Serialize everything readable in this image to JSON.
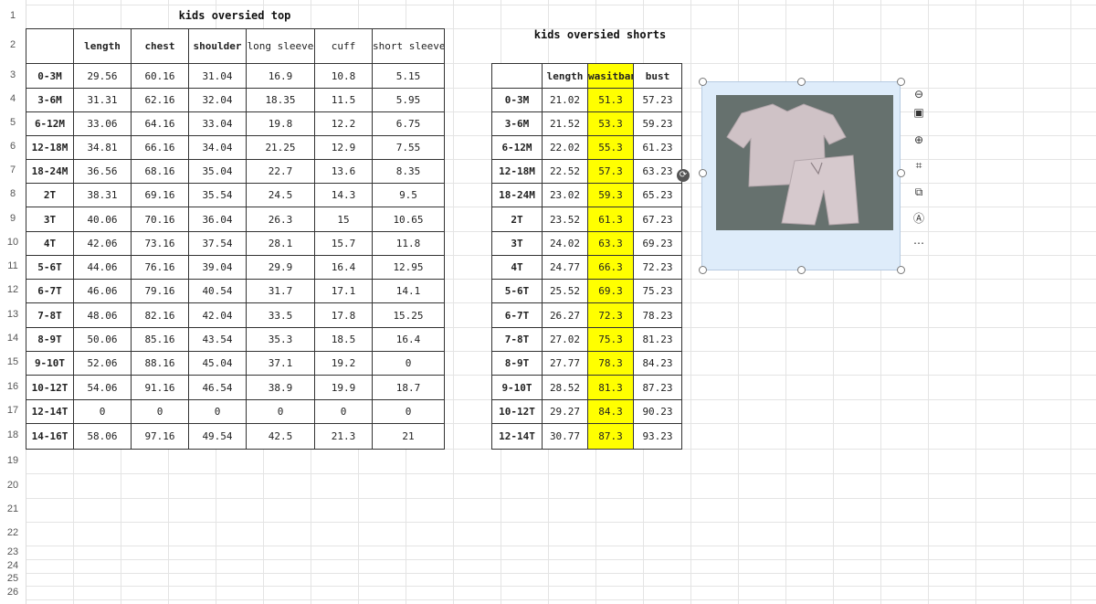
{
  "row_numbers": [
    "1",
    "2",
    "3",
    "4",
    "5",
    "6",
    "7",
    "8",
    "9",
    "10",
    "11",
    "12",
    "13",
    "14",
    "15",
    "16",
    "17",
    "18",
    "19",
    "20",
    "21",
    "22",
    "23",
    "24",
    "25",
    "26"
  ],
  "top_table": {
    "title": "kids oversied top",
    "headers": [
      "length",
      "chest",
      "shoulder",
      "long sleeve",
      "cuff",
      "short sleeve"
    ],
    "rows": [
      [
        "0-3M",
        "29.56",
        "60.16",
        "31.04",
        "16.9",
        "10.8",
        "5.15"
      ],
      [
        "3-6M",
        "31.31",
        "62.16",
        "32.04",
        "18.35",
        "11.5",
        "5.95"
      ],
      [
        "6-12M",
        "33.06",
        "64.16",
        "33.04",
        "19.8",
        "12.2",
        "6.75"
      ],
      [
        "12-18M",
        "34.81",
        "66.16",
        "34.04",
        "21.25",
        "12.9",
        "7.55"
      ],
      [
        "18-24M",
        "36.56",
        "68.16",
        "35.04",
        "22.7",
        "13.6",
        "8.35"
      ],
      [
        "2T",
        "38.31",
        "69.16",
        "35.54",
        "24.5",
        "14.3",
        "9.5"
      ],
      [
        "3T",
        "40.06",
        "70.16",
        "36.04",
        "26.3",
        "15",
        "10.65"
      ],
      [
        "4T",
        "42.06",
        "73.16",
        "37.54",
        "28.1",
        "15.7",
        "11.8"
      ],
      [
        "5-6T",
        "44.06",
        "76.16",
        "39.04",
        "29.9",
        "16.4",
        "12.95"
      ],
      [
        "6-7T",
        "46.06",
        "79.16",
        "40.54",
        "31.7",
        "17.1",
        "14.1"
      ],
      [
        "7-8T",
        "48.06",
        "82.16",
        "42.04",
        "33.5",
        "17.8",
        "15.25"
      ],
      [
        "8-9T",
        "50.06",
        "85.16",
        "43.54",
        "35.3",
        "18.5",
        "16.4"
      ],
      [
        "9-10T",
        "52.06",
        "88.16",
        "45.04",
        "37.1",
        "19.2",
        "0"
      ],
      [
        "10-12T",
        "54.06",
        "91.16",
        "46.54",
        "38.9",
        "19.9",
        "18.7"
      ],
      [
        "12-14T",
        "0",
        "0",
        "0",
        "0",
        "0",
        "0"
      ],
      [
        "14-16T",
        "58.06",
        "97.16",
        "49.54",
        "42.5",
        "21.3",
        "21"
      ]
    ]
  },
  "shorts_table": {
    "title": "kids oversied shorts",
    "headers": [
      "length",
      "wasitband",
      "bust"
    ],
    "rows": [
      [
        "0-3M",
        "21.02",
        "51.3",
        "57.23"
      ],
      [
        "3-6M",
        "21.52",
        "53.3",
        "59.23"
      ],
      [
        "6-12M",
        "22.02",
        "55.3",
        "61.23"
      ],
      [
        "12-18M",
        "22.52",
        "57.3",
        "63.23"
      ],
      [
        "18-24M",
        "23.02",
        "59.3",
        "65.23"
      ],
      [
        "2T",
        "23.52",
        "61.3",
        "67.23"
      ],
      [
        "3T",
        "24.02",
        "63.3",
        "69.23"
      ],
      [
        "4T",
        "24.77",
        "66.3",
        "72.23"
      ],
      [
        "5-6T",
        "25.52",
        "69.3",
        "75.23"
      ],
      [
        "6-7T",
        "26.27",
        "72.3",
        "78.23"
      ],
      [
        "7-8T",
        "27.02",
        "75.3",
        "81.23"
      ],
      [
        "8-9T",
        "27.77",
        "78.3",
        "84.23"
      ],
      [
        "9-10T",
        "28.52",
        "81.3",
        "87.23"
      ],
      [
        "10-12T",
        "29.27",
        "84.3",
        "90.23"
      ],
      [
        "12-14T",
        "30.77",
        "87.3",
        "93.23"
      ]
    ]
  },
  "colors": {
    "highlight": "#ffff00",
    "grid": "#e4e4e4",
    "border": "#333333"
  },
  "image_toolbar": {
    "icons": [
      "minus-icon",
      "image-icon",
      "zoom-in-icon",
      "crop-icon",
      "copy-icon",
      "text-recognize-icon",
      "more-icon"
    ]
  }
}
